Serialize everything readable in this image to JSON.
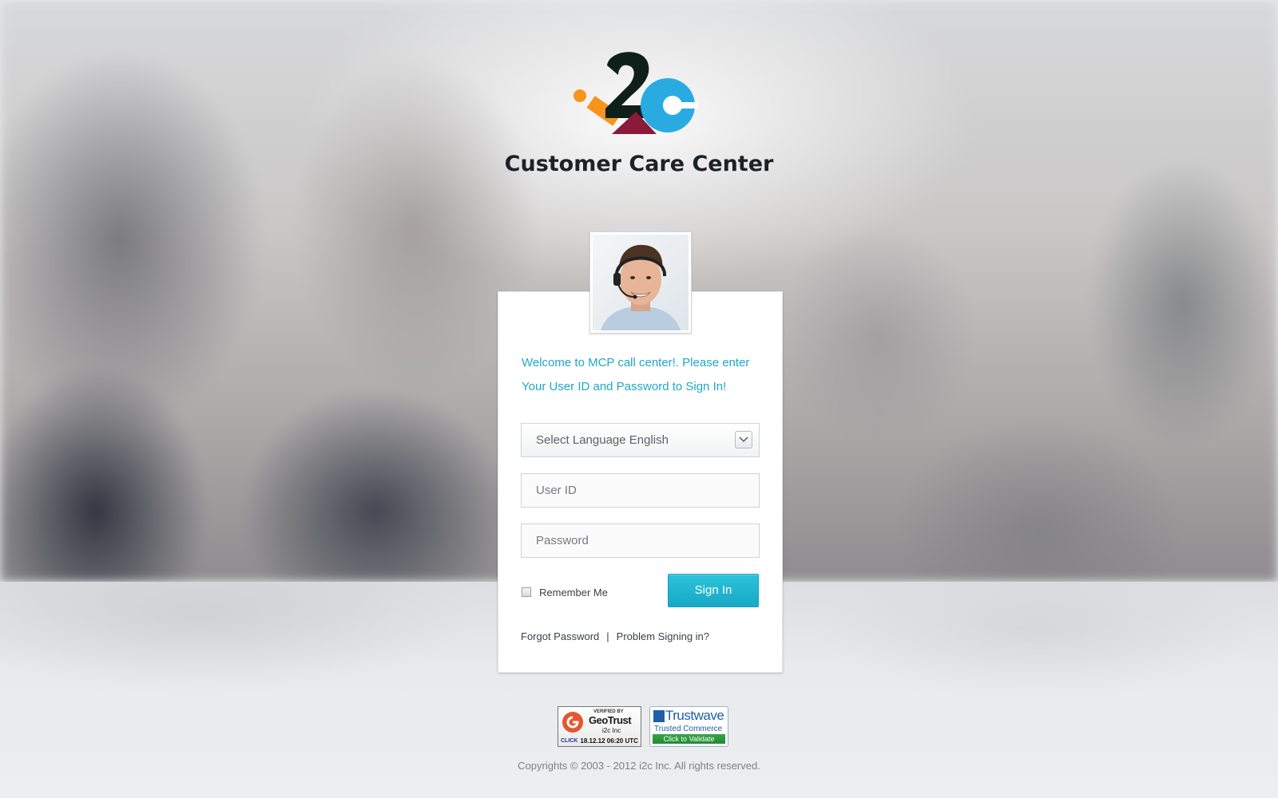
{
  "header": {
    "logo_text": "i2c",
    "title": "Customer Care Center"
  },
  "login": {
    "welcome_line1": "Welcome to MCP call center!. Please enter",
    "welcome_line2": "Your User ID and Password to Sign In!",
    "language_select": {
      "value": "Select Language English"
    },
    "user_id": {
      "placeholder": "User ID",
      "value": ""
    },
    "password": {
      "placeholder": "Password",
      "value": ""
    },
    "remember_me_label": "Remember Me",
    "remember_me_checked": false,
    "sign_in_label": "Sign In",
    "forgot_password_label": "Forgot Password",
    "separator": "|",
    "problem_signing_label": "Problem Signing in?"
  },
  "badges": {
    "geotrust": {
      "verified_by": "VERIFIED BY",
      "brand": "GeoTrust",
      "company": "i2c Inc",
      "click": "CLICK",
      "timestamp": "18.12.12 06:20 UTC"
    },
    "trustwave": {
      "brand": "Trustwave",
      "subtitle": "Trusted Commerce",
      "action": "Click to Validate"
    }
  },
  "footer": {
    "copyright": "Copyrights © 2003 - 2012 i2c Inc. All rights reserved."
  },
  "colors": {
    "accent": "#1ea7c9",
    "button": "#22b5d2",
    "logo_orange": "#f7941d",
    "logo_dark": "#0f1f1a",
    "logo_maroon": "#8b1a3a",
    "logo_blue": "#29abe2"
  }
}
